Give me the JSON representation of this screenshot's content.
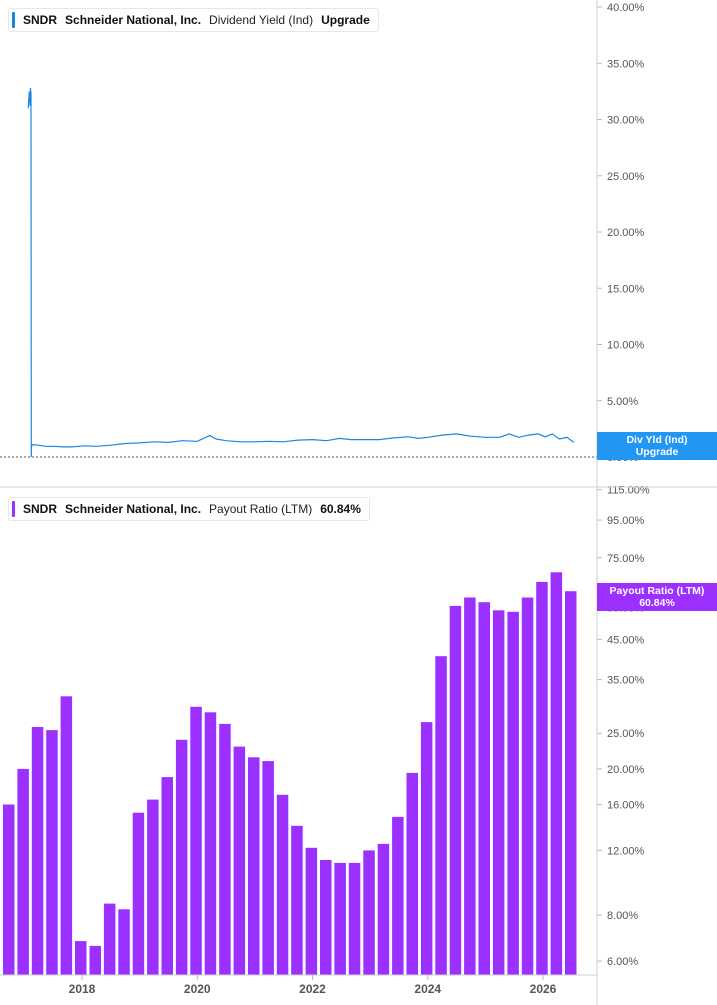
{
  "panel1": {
    "legend": {
      "ticker": "SNDR",
      "company": "Schneider National, Inc.",
      "metric": "Dividend Yield (Ind)",
      "extra": "Upgrade",
      "color": "#1b87e0"
    },
    "tag": {
      "line1": "Div Yld (Ind)",
      "line2": "Upgrade",
      "color": "#2196f3"
    }
  },
  "panel2": {
    "legend": {
      "ticker": "SNDR",
      "company": "Schneider National, Inc.",
      "metric": "Payout Ratio (LTM)",
      "extra": "60.84%",
      "color": "#9b30ff"
    },
    "tag": {
      "line1": "Payout Ratio (LTM)",
      "line2": "60.84%",
      "color": "#9b30ff"
    }
  },
  "chart_data": [
    {
      "type": "line",
      "series": [
        {
          "name": "Dividend Yield (Ind)",
          "x": [
            "2017-01-25",
            "2017-02-01",
            "2017-02-06",
            "2017-02-08",
            "2017-02-12",
            "2017-02-14",
            "2017-02-15",
            "2017-02-25",
            "2017-04-01",
            "2017-05-15",
            "2017-07-01",
            "2017-09-01",
            "2017-11-01",
            "2018-01-15",
            "2018-04-01",
            "2018-07-01",
            "2018-10-01",
            "2019-01-01",
            "2019-04-01",
            "2019-07-01",
            "2019-10-01",
            "2020-01-01",
            "2020-03-20",
            "2020-05-01",
            "2020-07-01",
            "2020-10-01",
            "2021-01-01",
            "2021-04-01",
            "2021-07-01",
            "2021-10-01",
            "2022-01-01",
            "2022-04-01",
            "2022-06-20",
            "2022-09-01",
            "2022-12-01",
            "2023-03-01",
            "2023-06-01",
            "2023-09-01",
            "2023-11-01",
            "2024-01-01",
            "2024-04-01",
            "2024-07-01",
            "2024-10-01",
            "2025-01-01",
            "2025-04-01",
            "2025-06-01",
            "2025-08-01",
            "2025-10-01",
            "2025-12-01",
            "2026-01-15",
            "2026-03-01",
            "2026-04-15",
            "2026-06-01",
            "2026-07-15"
          ],
          "values": [
            31.0,
            32.5,
            31.2,
            32.8,
            32.3,
            0,
            1.0,
            1.1,
            1.05,
            0.95,
            0.95,
            0.9,
            0.9,
            1.0,
            0.95,
            1.05,
            1.2,
            1.25,
            1.35,
            1.3,
            1.45,
            1.4,
            1.9,
            1.6,
            1.45,
            1.35,
            1.35,
            1.4,
            1.35,
            1.5,
            1.55,
            1.45,
            1.65,
            1.55,
            1.55,
            1.55,
            1.7,
            1.8,
            1.65,
            1.75,
            1.95,
            2.05,
            1.85,
            1.75,
            1.75,
            2.05,
            1.75,
            1.95,
            2.05,
            1.8,
            2.05,
            1.6,
            1.75,
            1.3
          ]
        }
      ],
      "ylim": [
        0,
        40
      ],
      "yticks": [
        "0.00%",
        "5.00%",
        "10.00%",
        "15.00%",
        "20.00%",
        "25.00%",
        "30.00%",
        "35.00%",
        "40.00%"
      ],
      "ytick_values": [
        0,
        5,
        10,
        15,
        20,
        25,
        30,
        35,
        40
      ]
    },
    {
      "type": "bar",
      "log_scale": true,
      "series": [
        {
          "name": "Payout Ratio (LTM)",
          "categories": [
            "2016-Q4",
            "2017-Q1",
            "2017-Q2",
            "2017-Q3",
            "2017-Q4",
            "2018-Q1",
            "2018-Q2",
            "2018-Q3",
            "2018-Q4",
            "2019-Q1",
            "2019-Q2",
            "2019-Q3",
            "2019-Q4",
            "2020-Q1",
            "2020-Q2",
            "2020-Q3",
            "2020-Q4",
            "2021-Q1",
            "2021-Q2",
            "2021-Q3",
            "2021-Q4",
            "2022-Q1",
            "2022-Q2",
            "2022-Q3",
            "2022-Q4",
            "2023-Q1",
            "2023-Q2",
            "2023-Q3",
            "2023-Q4",
            "2024-Q1",
            "2024-Q2",
            "2024-Q3",
            "2024-Q4",
            "2025-Q1",
            "2025-Q2",
            "2025-Q3",
            "2025-Q4",
            "2026-Q1",
            "2026-Q2",
            "2026-Q3"
          ],
          "values": [
            16.0,
            20.0,
            26.0,
            25.5,
            31.5,
            6.8,
            6.6,
            8.6,
            8.3,
            15.2,
            16.5,
            19.0,
            24.0,
            29.5,
            28.5,
            26.5,
            23.0,
            21.5,
            21.0,
            17.0,
            14.0,
            12.2,
            11.3,
            11.1,
            11.1,
            12.0,
            12.5,
            14.8,
            19.5,
            26.8,
            40.5,
            55.5,
            58.5,
            56.8,
            54.0,
            53.5,
            58.5,
            64.5,
            68.5,
            60.84
          ]
        }
      ],
      "ylim": [
        5.5,
        130
      ],
      "yticks": [
        "6.00%",
        "8.00%",
        "12.00%",
        "16.00%",
        "20.00%",
        "25.00%",
        "35.00%",
        "45.00%",
        "55.00%",
        "75.00%",
        "95.00%",
        "115.00%"
      ],
      "ytick_values": [
        6,
        8,
        12,
        16,
        20,
        25,
        35,
        45,
        55,
        75,
        95,
        115
      ],
      "xticks": [
        "2018",
        "2020",
        "2022",
        "2024",
        "2026"
      ]
    }
  ]
}
